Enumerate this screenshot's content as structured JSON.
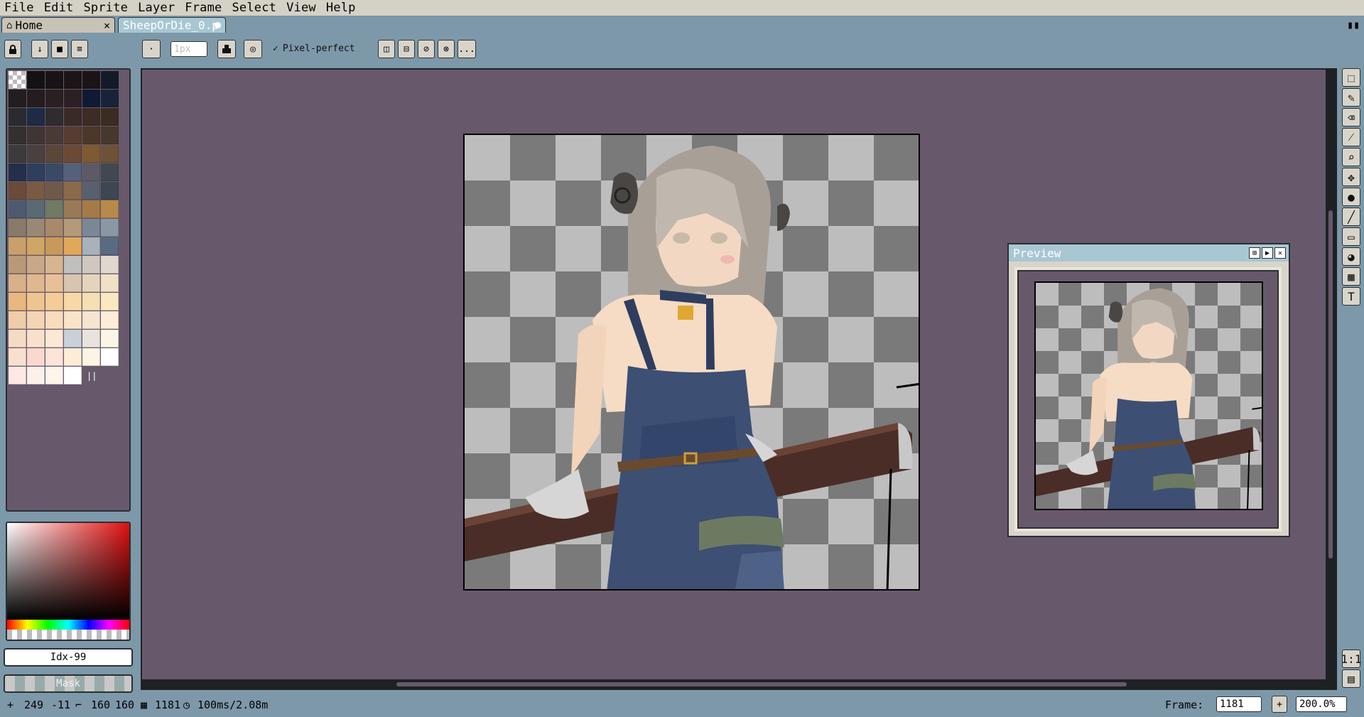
{
  "menu": {
    "items": [
      "File",
      "Edit",
      "Sprite",
      "Layer",
      "Frame",
      "Select",
      "View",
      "Help"
    ]
  },
  "tabs": {
    "home_label": "Home",
    "home_close": "×",
    "file_label": "SheepOrDie_0.p"
  },
  "toolbar": {
    "brush_size_placeholder": "1px",
    "pixel_perfect_label": "Pixel-perfect",
    "more_label": "..."
  },
  "palette": {
    "swatches": [
      [
        "#1a1a1e",
        "#121215",
        "#171316",
        "#1b1518",
        "#1a1417",
        "#131a2a"
      ],
      [
        "#221e1f",
        "#241c1e",
        "#2a2022",
        "#2c2024",
        "#101a33",
        "#18233a"
      ],
      [
        "#2a2b30",
        "#1d2b44",
        "#2f2c30",
        "#3a2a27",
        "#3e2b25",
        "#3b2c22"
      ],
      [
        "#34302f",
        "#3f3535",
        "#4a3a36",
        "#553d2f",
        "#4c3828",
        "#46382c"
      ],
      [
        "#3d3a3c",
        "#4a4040",
        "#5a4738",
        "#6b4a33",
        "#7e5a30",
        "#6d5235"
      ],
      [
        "#24304a",
        "#2d3f5c",
        "#3a4a66",
        "#55607a",
        "#5c5a66",
        "#42484f"
      ],
      [
        "#6a4a3a",
        "#7a5a42",
        "#6f5a4a",
        "#8a6a4a",
        "#586070",
        "#3e4652"
      ],
      [
        "#4d5a70",
        "#5a6a72",
        "#707a64",
        "#9a7a56",
        "#a57a48",
        "#b88a4a"
      ],
      [
        "#8a7a6a",
        "#9a8876",
        "#a68a6a",
        "#b49a7a",
        "#7a8896",
        "#8a98a6"
      ],
      [
        "#c9a06a",
        "#d0a664",
        "#c89a5a",
        "#e0a85a",
        "#a8b2ba",
        "#5a6a82"
      ],
      [
        "#b89a7a",
        "#c8a888",
        "#d6b590",
        "#c0c0c0",
        "#d0c8c0",
        "#e0d8cc"
      ],
      [
        "#d8b08a",
        "#e0b890",
        "#e8c098",
        "#d6c6b0",
        "#e4d4bc",
        "#f0e0c8"
      ],
      [
        "#e8b880",
        "#f0c490",
        "#f4cc98",
        "#f8d8a8",
        "#f4e0b4",
        "#fae8c0"
      ],
      [
        "#f0cca8",
        "#f4d4b4",
        "#f8dcbc",
        "#fae4c8",
        "#f4e4d0",
        "#fcecd8"
      ],
      [
        "#f4dcc4",
        "#f8e0cc",
        "#fce8d4",
        "#c8d0d8",
        "#e8e4dc",
        "#fcf4e4"
      ],
      [
        "#f8e0d0",
        "#fad8d0",
        "#fce4d8",
        "#fcecd8",
        "#fcf4e4",
        "#ffffff"
      ],
      [
        "#fde8e4",
        "#fdf0ea",
        "#fdf4ec",
        "#ffffff",
        "",
        ""
      ]
    ],
    "last_indicator": "||"
  },
  "color_index_label": "Idx-99",
  "mask_label": "Mask",
  "preview": {
    "title": "Preview"
  },
  "status": {
    "cursor_x": "249",
    "cursor_y": "-11",
    "size_w": "160",
    "size_h": "160",
    "frame_count": "1181",
    "timing": "100ms/2.08m",
    "frame_label": "Frame:",
    "frame_value": "1181",
    "zoom_value": "200.0%"
  },
  "rtools": [
    "marquee-tool",
    "pencil-tool",
    "eraser-tool",
    "eyedropper-tool",
    "zoom-tool",
    "move-tool",
    "fill-tool",
    "line-tool",
    "rectangle-tool",
    "contour-tool",
    "blur-tool",
    "text-tool"
  ],
  "colors": {
    "canvas_bg": "#67596b",
    "ui_bg": "#7d98a8",
    "active_tab": "#a8c7d3"
  }
}
